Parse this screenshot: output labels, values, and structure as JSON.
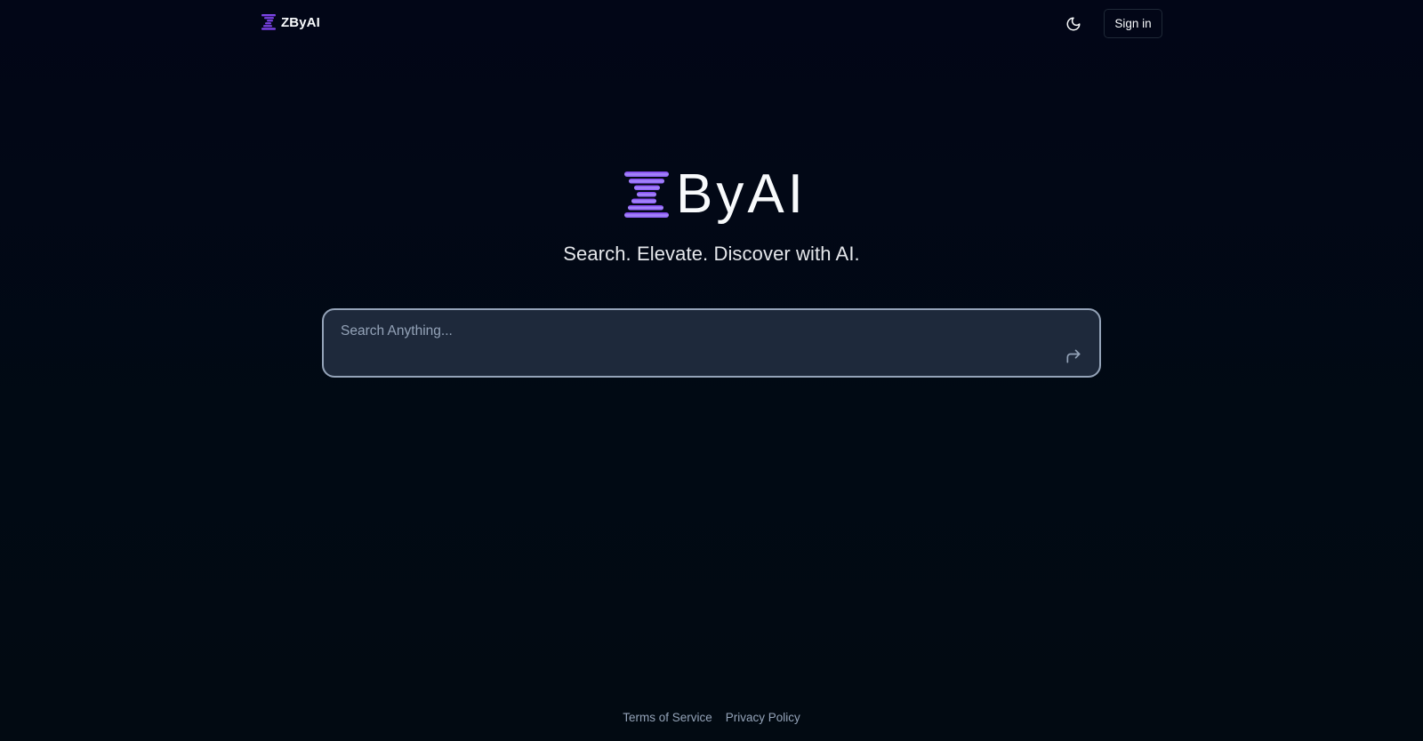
{
  "header": {
    "brand_name": "ZByAI",
    "logo_icon": "zbyai-logo-icon",
    "theme_icon": "moon-icon",
    "signin_label": "Sign in"
  },
  "hero": {
    "logo_text": "ByAI",
    "logo_icon": "zbyai-z-mark-icon",
    "tagline": "Search. Elevate. Discover with AI."
  },
  "search": {
    "placeholder": "Search Anything...",
    "value": "",
    "submit_icon": "forward-arrow-icon"
  },
  "footer": {
    "links": [
      "Terms of Service",
      "Privacy Policy"
    ]
  },
  "colors": {
    "background": "#020617",
    "accent_start": "#a78bfa",
    "accent_end": "#6d28d9",
    "search_bg": "#1e293b",
    "search_border": "#94a3b8"
  }
}
